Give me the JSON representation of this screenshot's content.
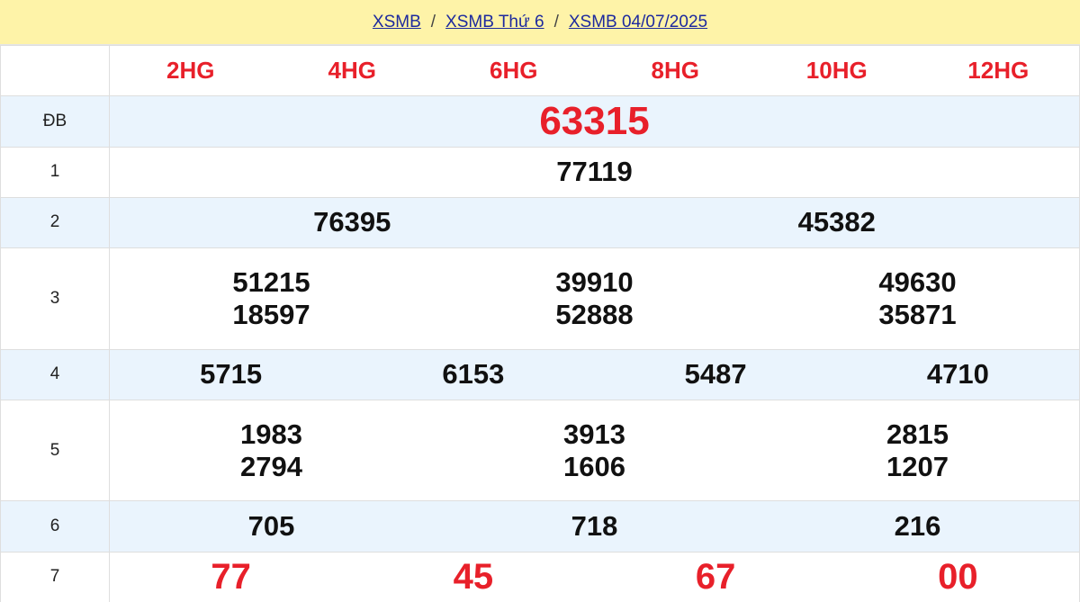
{
  "breadcrumb": {
    "items": [
      "XSMB",
      "XSMB Thứ 6",
      "XSMB 04/07/2025"
    ],
    "separator": "/"
  },
  "header": {
    "hg": [
      "2HG",
      "4HG",
      "6HG",
      "8HG",
      "10HG",
      "12HG"
    ]
  },
  "prizes": {
    "db": {
      "label": "ĐB",
      "numbers": [
        "63315"
      ]
    },
    "p1": {
      "label": "1",
      "numbers": [
        "77119"
      ]
    },
    "p2": {
      "label": "2",
      "numbers": [
        "76395",
        "45382"
      ]
    },
    "p3": {
      "label": "3",
      "numbers": [
        "51215",
        "39910",
        "49630",
        "18597",
        "52888",
        "35871"
      ]
    },
    "p4": {
      "label": "4",
      "numbers": [
        "5715",
        "6153",
        "5487",
        "4710"
      ]
    },
    "p5": {
      "label": "5",
      "numbers": [
        "1983",
        "3913",
        "2815",
        "2794",
        "1606",
        "1207"
      ]
    },
    "p6": {
      "label": "6",
      "numbers": [
        "705",
        "718",
        "216"
      ]
    },
    "p7": {
      "label": "7",
      "numbers": [
        "77",
        "45",
        "67",
        "00"
      ]
    }
  },
  "colors": {
    "accent_red": "#e8202a",
    "breadcrumb_bg": "#fef3a8",
    "link_blue": "#1d2a9e",
    "alt_row_bg": "#eaf4fd"
  }
}
